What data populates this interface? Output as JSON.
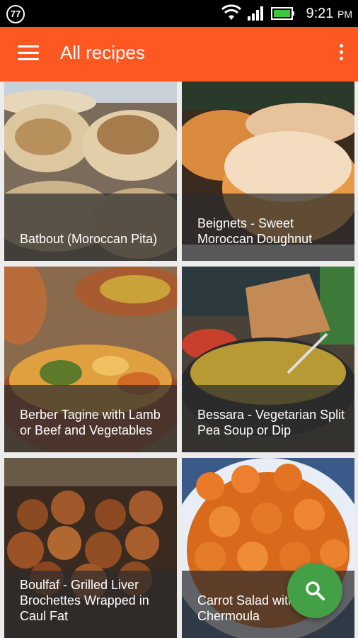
{
  "status_bar": {
    "badge": "77",
    "time": "9:21",
    "ampm": "PM",
    "icons": [
      "wifi-icon",
      "signal-icon",
      "battery-icon"
    ]
  },
  "app_bar": {
    "title": "All recipes",
    "color": "#ff5722",
    "icons": [
      "menu-icon",
      "overflow-menu-icon"
    ]
  },
  "recipes": [
    {
      "title": "Batbout (Moroccan Pita)"
    },
    {
      "title": "Beignets - Sweet Moroccan Doughnut"
    },
    {
      "title": "Berber Tagine with Lamb or Beef and Vegetables"
    },
    {
      "title": "Bessara - Vegetarian Split Pea Soup or Dip"
    },
    {
      "title": "Boulfaf - Grilled Liver Brochettes Wrapped in Caul Fat"
    },
    {
      "title": "Carrot Salad with Chermoula"
    }
  ],
  "fab": {
    "icon": "search-icon",
    "color": "#43a047"
  }
}
